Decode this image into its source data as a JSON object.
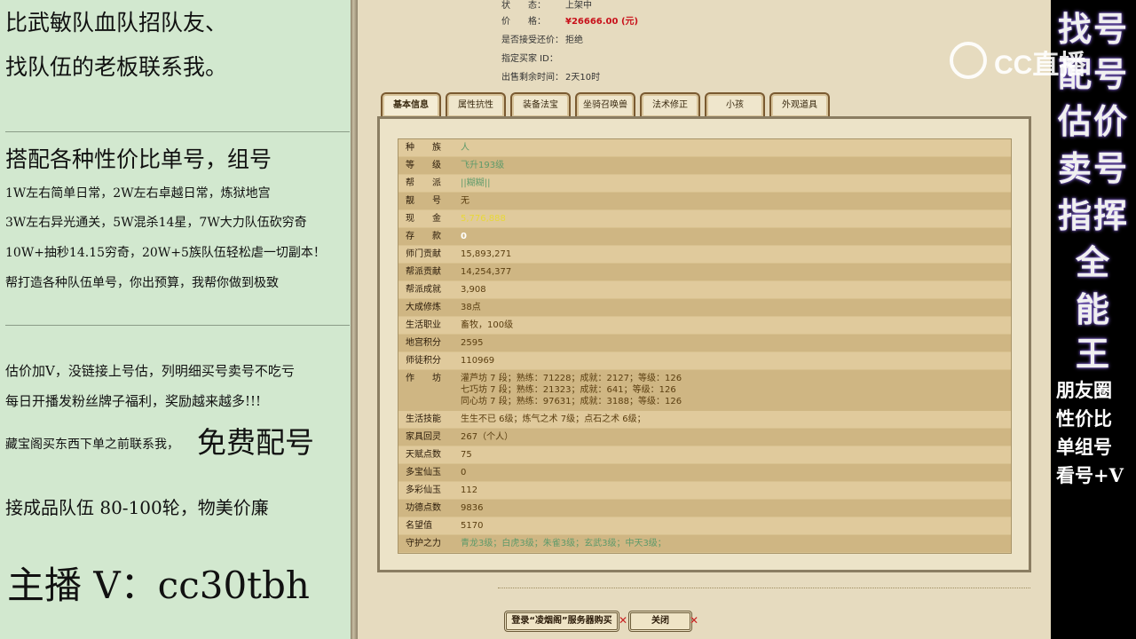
{
  "left_panel": {
    "line1": "比武敏队血队招队友、",
    "line2": "找队伍的老板联系我。",
    "line3": "搭配各种性价比单号，组号",
    "line4": "1W左右简单日常，2W左右卓越日常，炼狱地宫",
    "line5": "3W左右异光通关，5W混杀14星，7W大力队伍砍穷奇",
    "line6": "10W+抽秒14.15穷奇，20W+5族队伍轻松虐一切副本！",
    "line7": "帮打造各种队伍单号，你出预算，我帮你做到极致",
    "line8": "估价加V，没链接上号估，列明细买号卖号不吃亏",
    "line9": "每日开播发粉丝牌子福利，奖励越来越多!!!",
    "line10": "藏宝阁买东西下单之前联系我，",
    "free_offer": "免费配号",
    "line11": "接成品队伍 80-100轮，物美价廉",
    "streamer": "主播 V：cc30tbh"
  },
  "right_panel": {
    "big": [
      "找号",
      "配号",
      "估价",
      "卖号",
      "指挥",
      "全",
      "能",
      "王"
    ],
    "small": [
      "朋友圈",
      "性价比",
      "单组号",
      "看号+V"
    ],
    "logo_text": "CC直播"
  },
  "listing": {
    "status_label": "状　　态：",
    "status_value": "上架中",
    "price_label": "价　　格：",
    "price_value": "¥26666.00 (元)",
    "counter_label": "是否接受还价：",
    "counter_value": "拒绝",
    "buyer_label": "指定买家 ID：",
    "buyer_value": "",
    "time_label": "出售剩余时间：",
    "time_value": "2天10时"
  },
  "tabs": [
    "基本信息",
    "属性抗性",
    "装备法宝",
    "坐骑召唤兽",
    "法术修正",
    "小孩",
    "外观道具"
  ],
  "table_rows": [
    {
      "label": "种　　族",
      "value": "人",
      "style": "green"
    },
    {
      "label": "等　　级",
      "value": "飞升193级",
      "style": "green"
    },
    {
      "label": "帮　　派",
      "value": "||糊糊||",
      "style": "green"
    },
    {
      "label": "靓　　号",
      "value": "无",
      "style": ""
    },
    {
      "label": "现　　金",
      "value": "5,776,888",
      "style": "yellow"
    },
    {
      "label": "存　　款",
      "value": "0",
      "style": "white"
    },
    {
      "label": "师门贡献",
      "value": "15,893,271",
      "style": ""
    },
    {
      "label": "帮派贡献",
      "value": "14,254,377",
      "style": ""
    },
    {
      "label": "帮派成就",
      "value": "3,908",
      "style": ""
    },
    {
      "label": "大成修炼",
      "value": "38点",
      "style": ""
    },
    {
      "label": "生活职业",
      "value": "畜牧，100级",
      "style": ""
    },
    {
      "label": "地宫积分",
      "value": "2595",
      "style": ""
    },
    {
      "label": "师徒积分",
      "value": "110969",
      "style": ""
    }
  ],
  "workshop": {
    "label": "作　　坊",
    "lines": [
      "灌芦坊 7 段；熟练：71228；成就：2127；等级：126",
      "七巧坊 7 段；熟练：21323；成就：641；等级：126",
      "同心坊 7 段；熟练：97631；成就：3188；等级：126"
    ]
  },
  "table_rows2": [
    {
      "label": "生活技能",
      "value": "生生不已 6级；炼气之术 7级；点石之术 6级；",
      "style": ""
    },
    {
      "label": "家具回灵",
      "value": "267（个人）",
      "style": ""
    },
    {
      "label": "天赋点数",
      "value": "75",
      "style": ""
    },
    {
      "label": "多宝仙玉",
      "value": "0",
      "style": ""
    },
    {
      "label": "多彩仙玉",
      "value": "112",
      "style": ""
    },
    {
      "label": "功德点数",
      "value": "9836",
      "style": ""
    },
    {
      "label": "名望值",
      "value": "5170",
      "style": ""
    },
    {
      "label": "守护之力",
      "value": "青龙3级；白虎3级；朱雀3级；玄武3级；中天3级；",
      "style": "green"
    }
  ],
  "buttons": {
    "login_buy": "登录“凌烟阁”服务器购买",
    "close": "关闭"
  }
}
